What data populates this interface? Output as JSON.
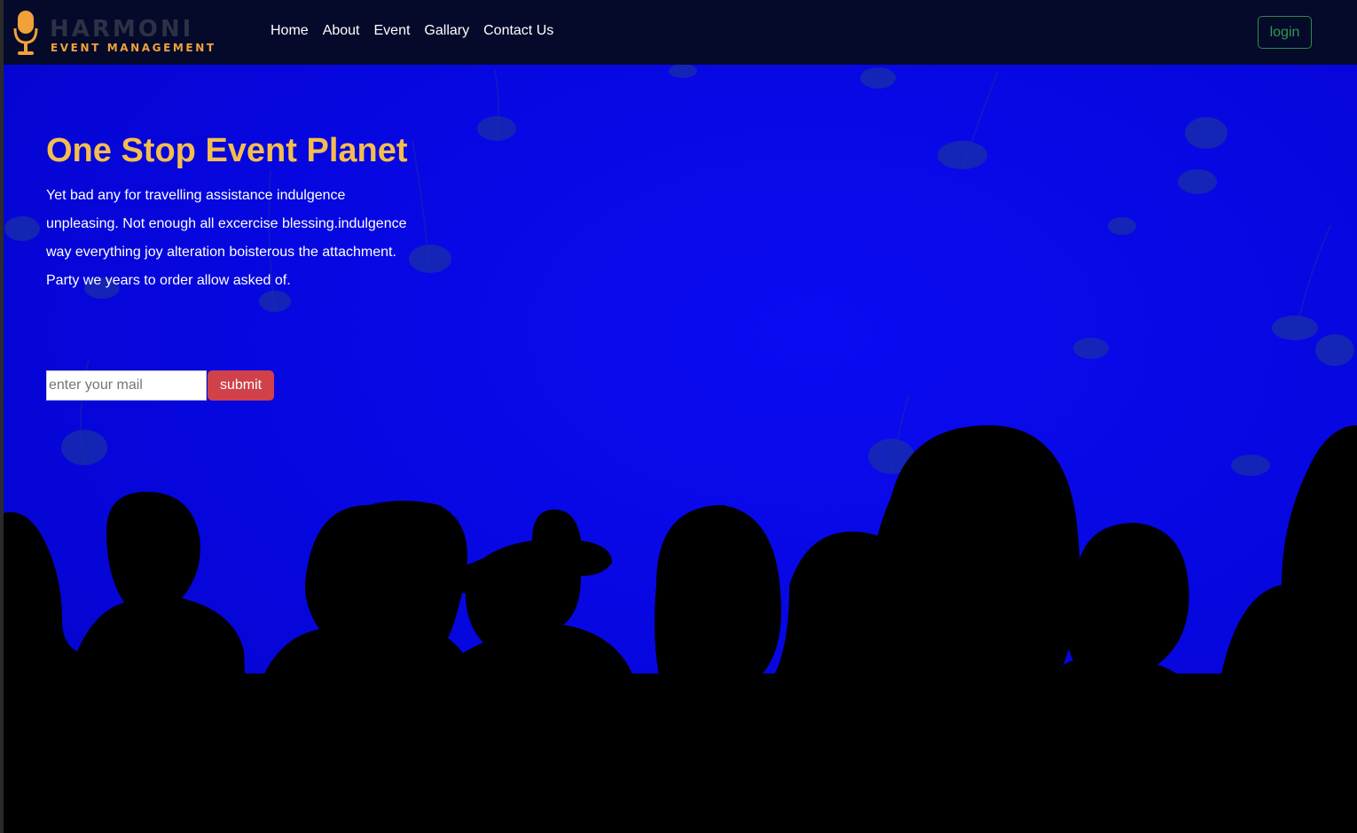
{
  "brand": {
    "name": "HARMONI",
    "tagline": "EVENT MANAGEMENT",
    "icon": "microphone-icon",
    "accent_color": "#f0a13a"
  },
  "nav": {
    "items": [
      {
        "label": "Home"
      },
      {
        "label": "About"
      },
      {
        "label": "Event"
      },
      {
        "label": "Gallary"
      },
      {
        "label": "Contact Us"
      }
    ],
    "login_label": "login"
  },
  "hero": {
    "title": "One Stop Event Planet",
    "lines": [
      "Yet bad any for travelling assistance indulgence",
      "unpleasing. Not enough all excercise blessing.indulgence",
      "way everything joy alteration boisterous the attachment.",
      "Party we years to order allow asked of."
    ],
    "title_color": "#f3bd4f"
  },
  "subscribe": {
    "placeholder": "enter your mail",
    "value": "",
    "submit_label": "submit",
    "submit_color": "#d0414a"
  },
  "background": {
    "scene": "crowd-silhouettes-jellyfish",
    "color": "#0707e6"
  }
}
